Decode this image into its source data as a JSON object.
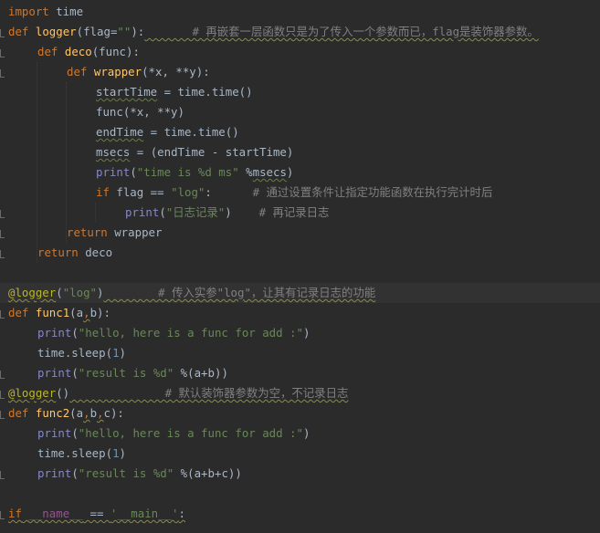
{
  "editor": {
    "language": "python",
    "theme": "dark",
    "colors": {
      "background": "#2b2b2b",
      "keyword": "#cc7832",
      "function": "#ffc66d",
      "string": "#6a8759",
      "number": "#6897bb",
      "comment": "#808080",
      "decorator": "#bbb529",
      "builtin": "#8888c6",
      "text": "#a9b7c6"
    },
    "lines": [
      {
        "indent": 0,
        "tokens": [
          {
            "t": "import",
            "c": "kw"
          },
          {
            "t": " time",
            "c": "pl"
          }
        ]
      },
      {
        "indent": 0,
        "tokens": [
          {
            "t": "def",
            "c": "kw"
          },
          {
            "t": " "
          },
          {
            "t": "logger",
            "c": "fn"
          },
          {
            "t": "(",
            "c": "pl"
          },
          {
            "t": "flag",
            "c": "pl"
          },
          {
            "t": "=",
            "c": "pl"
          },
          {
            "t": "\"\"",
            "c": "str"
          },
          {
            "t": "):",
            "c": "pl"
          },
          {
            "t": "       # 再嵌套一层函数只是为了传入一个参数而已，flag是装饰器参数。",
            "c": "cmt",
            "u": "wg"
          }
        ]
      },
      {
        "indent": 1,
        "tokens": [
          {
            "t": "def",
            "c": "kw"
          },
          {
            "t": " "
          },
          {
            "t": "deco",
            "c": "fn"
          },
          {
            "t": "(func):",
            "c": "pl"
          }
        ]
      },
      {
        "indent": 2,
        "tokens": [
          {
            "t": "def",
            "c": "kw"
          },
          {
            "t": " "
          },
          {
            "t": "wrapper",
            "c": "fn"
          },
          {
            "t": "(*x, **y):",
            "c": "pl"
          }
        ]
      },
      {
        "indent": 3,
        "tokens": [
          {
            "t": "startTime",
            "c": "pl",
            "u": "wv"
          },
          {
            "t": " = time.time()",
            "c": "pl"
          }
        ]
      },
      {
        "indent": 3,
        "tokens": [
          {
            "t": "func(*x, **y)",
            "c": "pl"
          }
        ]
      },
      {
        "indent": 3,
        "tokens": [
          {
            "t": "endTime",
            "c": "pl",
            "u": "wv"
          },
          {
            "t": " = time.time()",
            "c": "pl"
          }
        ]
      },
      {
        "indent": 3,
        "tokens": [
          {
            "t": "msecs",
            "c": "pl",
            "u": "wv"
          },
          {
            "t": " = (endTime - startTime)",
            "c": "pl"
          }
        ]
      },
      {
        "indent": 3,
        "tokens": [
          {
            "t": "print",
            "c": "bi"
          },
          {
            "t": "(",
            "c": "pl"
          },
          {
            "t": "\"time is %d ms\"",
            "c": "str"
          },
          {
            "t": " %",
            "c": "pl"
          },
          {
            "t": "msecs",
            "c": "pl",
            "u": "wv"
          },
          {
            "t": ")",
            "c": "pl"
          }
        ]
      },
      {
        "indent": 3,
        "tokens": [
          {
            "t": "if",
            "c": "kw"
          },
          {
            "t": " flag == ",
            "c": "pl"
          },
          {
            "t": "\"log\"",
            "c": "str"
          },
          {
            "t": ":",
            "c": "pl"
          },
          {
            "t": "      # 通过设置条件让指定功能函数在执行完计时后",
            "c": "cmt"
          }
        ]
      },
      {
        "indent": 4,
        "tokens": [
          {
            "t": "print",
            "c": "bi"
          },
          {
            "t": "(",
            "c": "pl"
          },
          {
            "t": "\"日志记录\"",
            "c": "str"
          },
          {
            "t": ")",
            "c": "pl"
          },
          {
            "t": "    # 再记录日志",
            "c": "cmt"
          }
        ]
      },
      {
        "indent": 2,
        "tokens": [
          {
            "t": "return",
            "c": "kw"
          },
          {
            "t": " wrapper",
            "c": "pl"
          }
        ]
      },
      {
        "indent": 1,
        "tokens": [
          {
            "t": "return",
            "c": "kw"
          },
          {
            "t": " deco",
            "c": "pl"
          }
        ]
      },
      {
        "indent": 0,
        "tokens": []
      },
      {
        "indent": 0,
        "current": true,
        "tokens": [
          {
            "t": "@logger",
            "c": "dec",
            "u": "wg"
          },
          {
            "t": "(",
            "c": "pl"
          },
          {
            "t": "\"log\"",
            "c": "str"
          },
          {
            "t": ")",
            "c": "pl"
          },
          {
            "t": "        # 传入实参\"log\"，让其有记录日志的功能",
            "c": "cmt",
            "u": "wg"
          }
        ]
      },
      {
        "indent": 0,
        "tokens": [
          {
            "t": "def",
            "c": "kw"
          },
          {
            "t": " "
          },
          {
            "t": "func1",
            "c": "fn"
          },
          {
            "t": "(a",
            "c": "pl"
          },
          {
            "t": ",",
            "c": "kw",
            "u": "wg"
          },
          {
            "t": "b):",
            "c": "pl"
          }
        ]
      },
      {
        "indent": 1,
        "tokens": [
          {
            "t": "print",
            "c": "bi"
          },
          {
            "t": "(",
            "c": "pl"
          },
          {
            "t": "\"hello, here is a func for add :\"",
            "c": "str"
          },
          {
            "t": ")",
            "c": "pl"
          }
        ]
      },
      {
        "indent": 1,
        "tokens": [
          {
            "t": "time.sleep(",
            "c": "pl"
          },
          {
            "t": "1",
            "c": "num"
          },
          {
            "t": ")",
            "c": "pl"
          }
        ]
      },
      {
        "indent": 1,
        "tokens": [
          {
            "t": "print",
            "c": "bi"
          },
          {
            "t": "(",
            "c": "pl"
          },
          {
            "t": "\"result is %d\"",
            "c": "str"
          },
          {
            "t": " %",
            "c": "pl"
          },
          {
            "t": "(a+b))",
            "c": "pl"
          }
        ]
      },
      {
        "indent": 0,
        "tokens": [
          {
            "t": "@logger",
            "c": "dec",
            "u": "wg"
          },
          {
            "t": "()",
            "c": "pl"
          },
          {
            "t": "              # 默认装饰器参数为空，不记录日志",
            "c": "cmt",
            "u": "wg"
          }
        ]
      },
      {
        "indent": 0,
        "tokens": [
          {
            "t": "def",
            "c": "kw"
          },
          {
            "t": " "
          },
          {
            "t": "func2",
            "c": "fn"
          },
          {
            "t": "(a",
            "c": "pl"
          },
          {
            "t": ",",
            "c": "kw",
            "u": "wg"
          },
          {
            "t": "b",
            "c": "pl"
          },
          {
            "t": ",",
            "c": "kw",
            "u": "wg"
          },
          {
            "t": "c):",
            "c": "pl"
          }
        ]
      },
      {
        "indent": 1,
        "tokens": [
          {
            "t": "print",
            "c": "bi"
          },
          {
            "t": "(",
            "c": "pl"
          },
          {
            "t": "\"hello, here is a func for add :\"",
            "c": "str"
          },
          {
            "t": ")",
            "c": "pl"
          }
        ]
      },
      {
        "indent": 1,
        "tokens": [
          {
            "t": "time.sleep(",
            "c": "pl"
          },
          {
            "t": "1",
            "c": "num"
          },
          {
            "t": ")",
            "c": "pl"
          }
        ]
      },
      {
        "indent": 1,
        "tokens": [
          {
            "t": "print",
            "c": "bi"
          },
          {
            "t": "(",
            "c": "pl"
          },
          {
            "t": "\"result is %d\"",
            "c": "str"
          },
          {
            "t": " %",
            "c": "pl"
          },
          {
            "t": "(a+b+c))",
            "c": "pl"
          }
        ]
      },
      {
        "indent": 0,
        "tokens": []
      },
      {
        "indent": 0,
        "tokens": [
          {
            "t": "if",
            "c": "kw",
            "u": "wg"
          },
          {
            "t": " ",
            "c": "pl",
            "u": "wg"
          },
          {
            "t": "__name__",
            "c": "prm",
            "u": "wg"
          },
          {
            "t": " == ",
            "c": "pl",
            "u": "wg"
          },
          {
            "t": "'__main__'",
            "c": "str",
            "u": "wg"
          },
          {
            "t": ":",
            "c": "pl",
            "u": "wg"
          }
        ]
      }
    ]
  }
}
